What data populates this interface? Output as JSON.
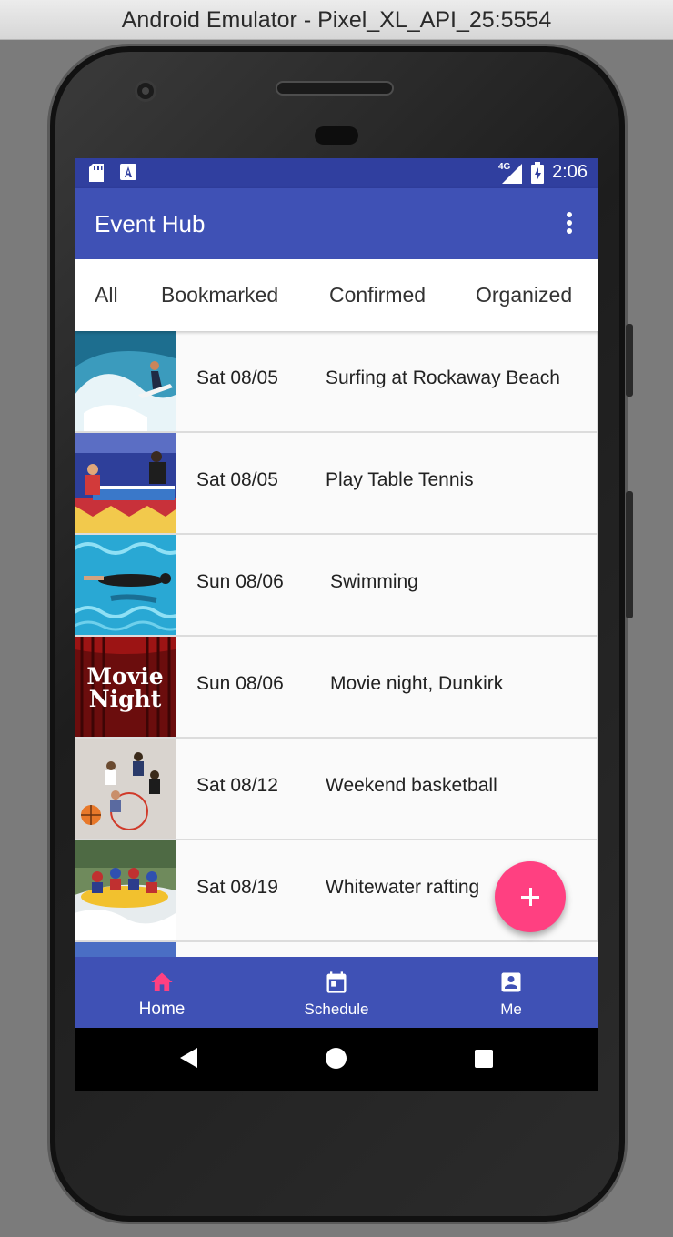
{
  "window": {
    "title": "Android Emulator - Pixel_XL_API_25:5554"
  },
  "status_bar": {
    "time": "2:06",
    "network": "4G",
    "icons": [
      "sd-card-icon",
      "font-a-icon",
      "signal-icon",
      "battery-charging-icon"
    ]
  },
  "app_bar": {
    "title": "Event Hub",
    "menu_icon": "more-vert-icon"
  },
  "tabs": [
    {
      "label": "All"
    },
    {
      "label": "Bookmarked"
    },
    {
      "label": "Confirmed"
    },
    {
      "label": "Organized"
    }
  ],
  "events": [
    {
      "date": "Sat 08/05",
      "title": "Surfing at Rockaway Beach",
      "image": "surfing"
    },
    {
      "date": "Sat 08/05",
      "title": "Play Table Tennis",
      "image": "table-tennis"
    },
    {
      "date": "Sun 08/06",
      "title": "Swimming",
      "image": "swimming"
    },
    {
      "date": "Sun 08/06",
      "title": "Movie night, Dunkirk",
      "image": "movie-night",
      "image_text": "Movie Night"
    },
    {
      "date": "Sat 08/12",
      "title": "Weekend basketball",
      "image": "basketball"
    },
    {
      "date": "Sat 08/19",
      "title": "Whitewater rafting",
      "image": "rafting"
    }
  ],
  "fab": {
    "icon": "add-icon"
  },
  "bottom_nav": [
    {
      "label": "Home",
      "icon": "home-icon",
      "active": true
    },
    {
      "label": "Schedule",
      "icon": "calendar-icon",
      "active": false
    },
    {
      "label": "Me",
      "icon": "account-box-icon",
      "active": false
    }
  ],
  "system_nav": [
    "back-icon",
    "home-circle-icon",
    "recents-icon"
  ],
  "colors": {
    "primary": "#3f51b5",
    "primary_dark": "#303f9f",
    "accent": "#ff4081",
    "active_nav_icon": "#ff4081"
  }
}
